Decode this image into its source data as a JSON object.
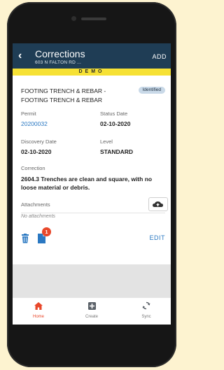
{
  "header": {
    "title": "Corrections",
    "subtitle": "603 N FALTON RD ...",
    "add_label": "ADD"
  },
  "banner": {
    "text": "DEMO"
  },
  "correction": {
    "title": "FOOTING TRENCH & REBAR - FOOTING TRENCH & REBAR",
    "status": "Identified",
    "permit_label": "Permit",
    "permit_value": "20200032",
    "status_date_label": "Status Date",
    "status_date_value": "02-10-2020",
    "discovery_date_label": "Discovery Date",
    "discovery_date_value": "02-10-2020",
    "level_label": "Level",
    "level_value": "STANDARD",
    "correction_label": "Correction",
    "correction_text": "2604.3 Trenches are clean and square, with no loose material or debris.",
    "attachments_label": "Attachments",
    "no_attachments": "No attachments",
    "notification_count": "1",
    "edit_label": "EDIT"
  },
  "bottom_nav": [
    {
      "label": "Home",
      "icon": "home-icon",
      "active": true
    },
    {
      "label": "Create",
      "icon": "plus-icon",
      "active": false
    },
    {
      "label": "Sync",
      "icon": "sync-icon",
      "active": false
    }
  ],
  "colors": {
    "header_bg": "#1f3d55",
    "demo_banner": "#f6e135",
    "accent_blue": "#2a78c2",
    "badge_bg": "#c9d9e8",
    "notification": "#e8472a"
  }
}
